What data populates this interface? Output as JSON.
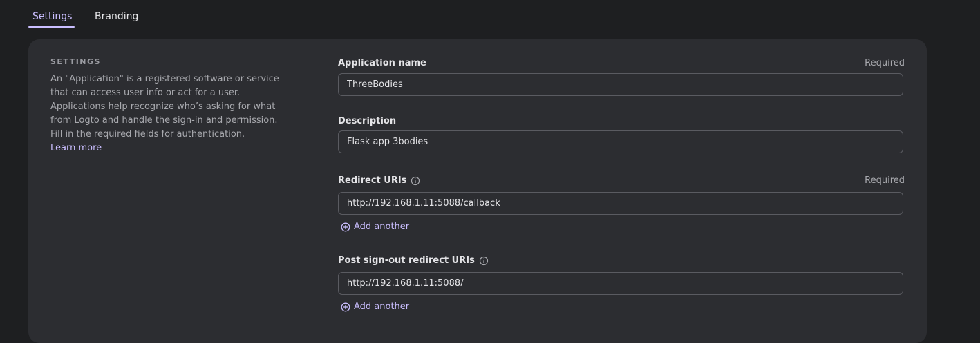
{
  "tabs": [
    {
      "label": "Settings",
      "active": true
    },
    {
      "label": "Branding",
      "active": false
    }
  ],
  "settings": {
    "title": "SETTINGS",
    "description": "An \"Application\" is a registered software or service that can access user info or act for a user. Applications help recognize who’s asking for what from Logto and handle the sign-in and permission. Fill in the required fields for authentication.",
    "learn_more": "Learn more"
  },
  "fields": {
    "app_name": {
      "label": "Application name",
      "required": "Required",
      "value": "ThreeBodies"
    },
    "description": {
      "label": "Description",
      "value": "Flask app 3bodies"
    },
    "redirect_uris": {
      "label": "Redirect URIs",
      "required": "Required",
      "value": "http://192.168.1.11:5088/callback",
      "add_label": "Add another"
    },
    "post_signout_uris": {
      "label": "Post sign-out redirect URIs",
      "value": "http://192.168.1.11:5088/",
      "add_label": "Add another"
    }
  },
  "icons": {
    "info": "info-circle-icon",
    "add": "plus-circle-icon"
  },
  "colors": {
    "accent": "#cabeff",
    "background": "#1e1f21",
    "card": "#2c2d31"
  }
}
